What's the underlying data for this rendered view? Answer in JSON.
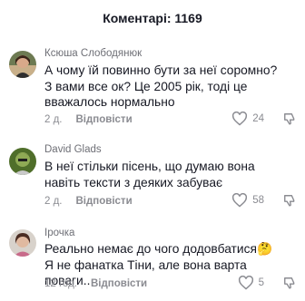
{
  "header": {
    "title": "Коментарі: 1169"
  },
  "comments": [
    {
      "author": "Ксюша Слободянюк",
      "text": "А чому їй повинно бути за неї соромно?\nЗ вами все ок? Це 2005 рік, тоді це\nвважалось нормально",
      "time": "2 д.",
      "reply_label": "Відповісти",
      "likes": "24"
    },
    {
      "author": "David Glads",
      "text": "В неї стільки пісень, що думаю вона\nнавіть тексти з деяких забуває",
      "time": "2 д.",
      "reply_label": "Відповісти",
      "likes": "58"
    },
    {
      "author": "Ірочка",
      "text": "Реально немає до чого додовбатися🤔\nЯ не фанатка Тіни, але вона варта поваги..",
      "time": "12 год.",
      "reply_label": "Відповісти",
      "likes": "5"
    }
  ]
}
